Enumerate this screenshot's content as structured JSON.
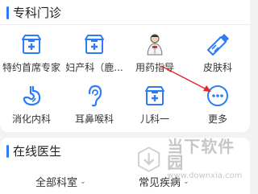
{
  "sections": {
    "departments_title": "专科门诊",
    "doctors_title": "在线医生"
  },
  "departments": [
    {
      "label": "特约首席专家",
      "icon": "hospital-icon"
    },
    {
      "label": "妇产科（鹿...",
      "icon": "hospital-icon"
    },
    {
      "label": "用药指导",
      "icon": "doctor-icon"
    },
    {
      "label": "皮肤科",
      "icon": "skin-cream-icon"
    },
    {
      "label": "消化内科",
      "icon": "stomach-icon"
    },
    {
      "label": "耳鼻喉科",
      "icon": "ear-icon"
    },
    {
      "label": "儿科一",
      "icon": "hospital-icon"
    },
    {
      "label": "更多",
      "icon": "more-dots-icon"
    }
  ],
  "filters": {
    "department": "全部科室",
    "disease": "常见疾病"
  },
  "watermark": {
    "main": "当下软件园",
    "sub": "www.downxia.com"
  },
  "colors": {
    "accent": "#2d7cf6",
    "arrow": "#e8262a"
  }
}
